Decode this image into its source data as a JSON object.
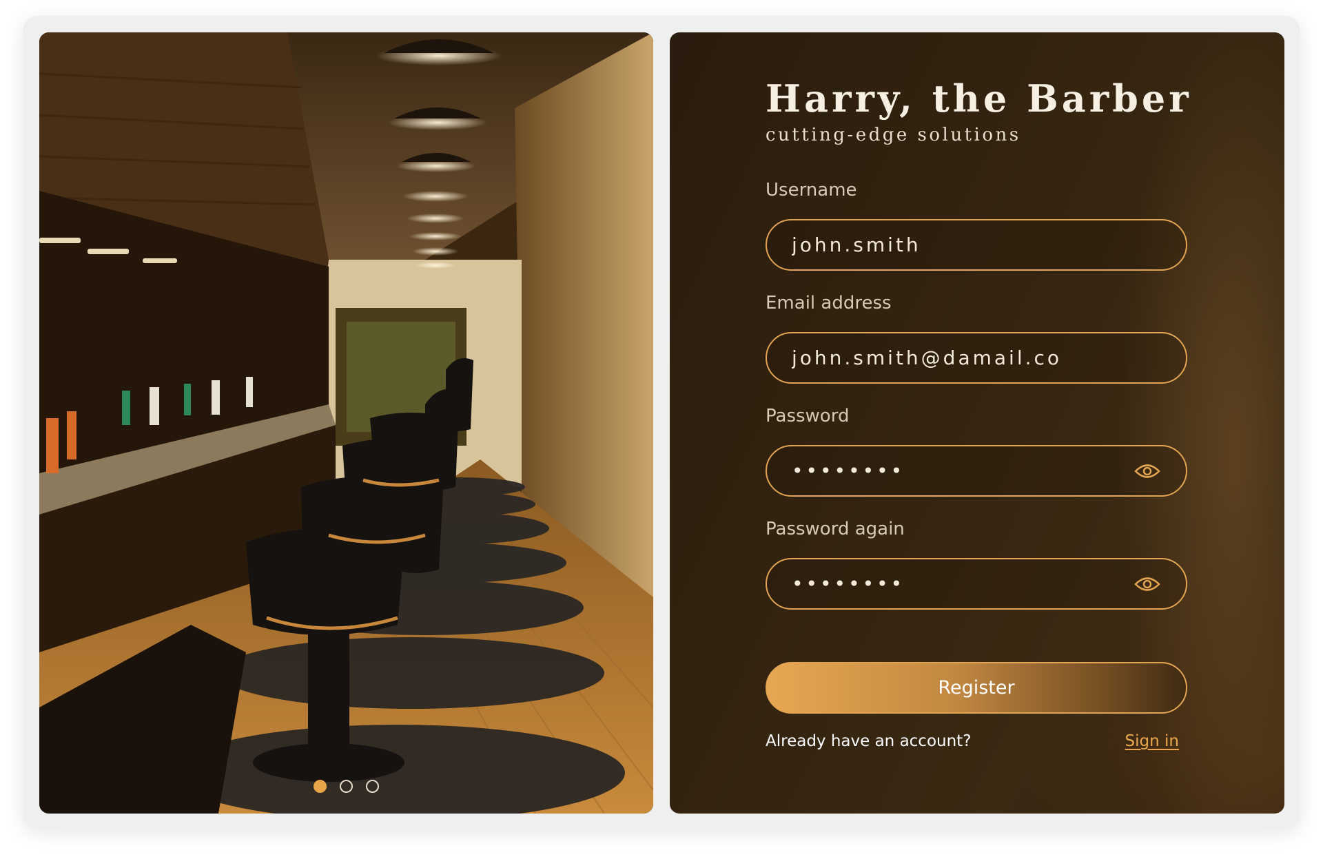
{
  "brand": {
    "title": "Harry, the Barber",
    "tagline": "cutting-edge solutions"
  },
  "form": {
    "username": {
      "label": "Username",
      "value": "john.smith"
    },
    "email": {
      "label": "Email address",
      "value": "john.smith@damail.co"
    },
    "password": {
      "label": "Password",
      "value": "••••••••"
    },
    "password_again": {
      "label": "Password again",
      "value": "••••••••"
    },
    "register_label": "Register",
    "signin_prompt": "Already have an account?",
    "signin_link": "Sign in"
  },
  "carousel": {
    "slide_count": 3,
    "active_index": 0,
    "image": "barbershop-interior-photo"
  },
  "colors": {
    "accent": "#e3a552",
    "panel_bg": "#2f2110",
    "card_bg": "#efefef",
    "text_light": "#f6efe2"
  }
}
